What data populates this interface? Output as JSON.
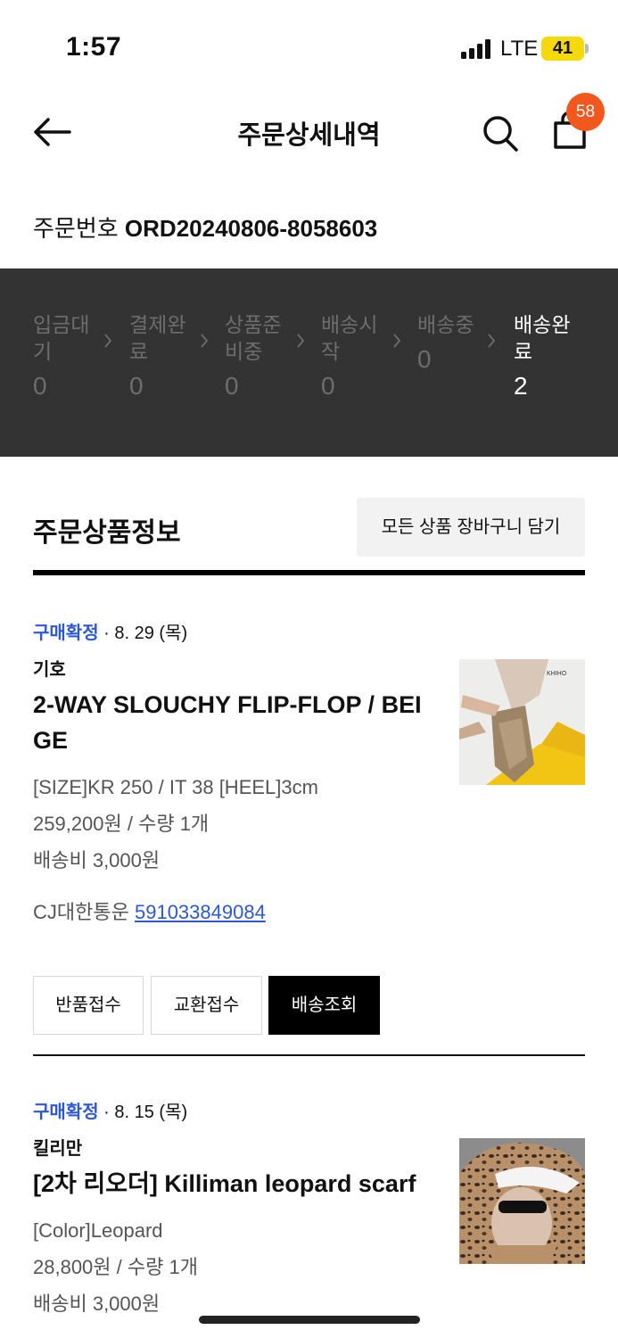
{
  "status_bar": {
    "time": "1:57",
    "network": "LTE",
    "battery": "41"
  },
  "header": {
    "title": "주문상세내역",
    "cart_count": "58"
  },
  "order": {
    "number_label": "주문번호",
    "number_value": "ORD20240806-8058603"
  },
  "progress": {
    "steps": [
      {
        "label": "입금대기",
        "count": "0"
      },
      {
        "label": "결제완료",
        "count": "0"
      },
      {
        "label": "상품준비중",
        "count": "0"
      },
      {
        "label": "배송시작",
        "count": "0"
      },
      {
        "label": "배송중",
        "count": "0"
      },
      {
        "label": "배송완료",
        "count": "2"
      }
    ],
    "active_step": 5
  },
  "section": {
    "title": "주문상품정보",
    "add_all_label": "모든 상품 장바구니 담기"
  },
  "items": [
    {
      "status": "구매확정",
      "date": "· 8. 29 (목)",
      "brand": "기호",
      "name": "2-WAY SLOUCHY FLIP-FLOP / BEIGE",
      "option": "[SIZE]KR 250 / IT 38 [HEEL]3cm",
      "price": "259,200원 / 수량 1개",
      "shipping": "배송비 3,000원",
      "courier": "CJ대한통운",
      "tracking_no": "591033849084",
      "thumb_text": "KHIHO",
      "buttons": {
        "return": "반품접수",
        "exchange": "교환접수",
        "track": "배송조회"
      }
    },
    {
      "status": "구매확정",
      "date": "· 8. 15 (목)",
      "brand": "킬리만",
      "name": "[2차 리오더] Killiman leopard scarf",
      "option": "[Color]Leopard",
      "price": "28,800원 / 수량 1개",
      "shipping": "배송비 3,000원"
    }
  ],
  "colors": {
    "accent_blue": "#2a58d6",
    "progress_bg": "#333333",
    "badge": "#f2581e"
  }
}
